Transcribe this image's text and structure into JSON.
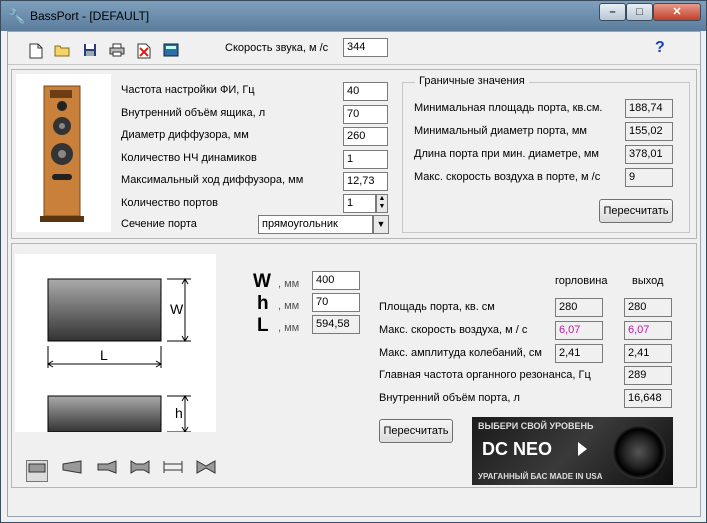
{
  "window": {
    "title": "BassPort - [DEFAULT]",
    "controls": {
      "minimize": "–",
      "maximize": "□",
      "close": "✕"
    }
  },
  "toolbar": {
    "icons": [
      "new-file-icon",
      "open-folder-icon",
      "save-icon",
      "print-icon",
      "delete-icon",
      "calculator-icon"
    ],
    "sound_speed_label": "Скорость звука, м /с",
    "sound_speed_value": "344",
    "help_label": "?"
  },
  "params": {
    "tuning_freq_label": "Частота настройки ФИ, Гц",
    "tuning_freq_value": "40",
    "box_volume_label": "Внутренний объём ящика, л",
    "box_volume_value": "70",
    "cone_diameter_label": "Диаметр диффузора, мм",
    "cone_diameter_value": "260",
    "driver_count_label": "Количество НЧ динамиков",
    "driver_count_value": "1",
    "max_excursion_label": "Максимальный ход диффузора, мм",
    "max_excursion_value": "12,73",
    "port_count_label": "Количество портов",
    "port_count_value": "1",
    "port_section_label": "Сечение порта",
    "port_section_value": "прямоугольник"
  },
  "limits": {
    "title": "Граничные значения",
    "min_area_label": "Минимальная площадь порта, кв.см.",
    "min_area_value": "188,74",
    "min_diameter_label": "Минимальный диаметр порта, мм",
    "min_diameter_value": "155,02",
    "length_at_min_label": "Длина порта при мин. диаметре, мм",
    "length_at_min_value": "378,01",
    "max_air_speed_label": "Макс. скорость воздуха в порте, м /с",
    "max_air_speed_value": "9",
    "recalc_label": "Пересчитать"
  },
  "dimensions": {
    "w_letter": "W",
    "h_letter": "h",
    "l_letter": "L",
    "unit": ", мм",
    "w_value": "400",
    "h_value": "70",
    "l_value": "594,58",
    "diagram_w": "W",
    "diagram_l": "L",
    "diagram_h": "h"
  },
  "results": {
    "col_throat": "горловина",
    "col_exit": "выход",
    "port_area_label": "Площадь порта, кв. см",
    "port_area_throat": "280",
    "port_area_exit": "280",
    "air_speed_label": "Макс. скорость воздуха, м / с",
    "air_speed_throat": "6,07",
    "air_speed_exit": "6,07",
    "amplitude_label": "Макс. амплитуда колебаний, см",
    "amplitude_throat": "2,41",
    "amplitude_exit": "2,41",
    "resonance_label": "Главная частота органного резонанса, Гц",
    "resonance_value": "289",
    "port_volume_label": "Внутренний объём порта, л",
    "port_volume_value": "16,648",
    "recalc_label": "Пересчитать"
  },
  "ad": {
    "top_text": "ВЫБЕРИ СВОЙ УРОВЕНЬ",
    "brand": "DC NEO",
    "bottom_text": "УРАГАННЫЙ БАС MADE IN USA"
  },
  "shapes": [
    "rectangle-port-icon",
    "tapered-port-icon",
    "flared-port-icon",
    "double-flared-port-icon",
    "straight-tube-icon",
    "bowtie-port-icon"
  ],
  "colors": {
    "accent_pink": "#c01aa8",
    "title_bar": "#6a8bab"
  }
}
